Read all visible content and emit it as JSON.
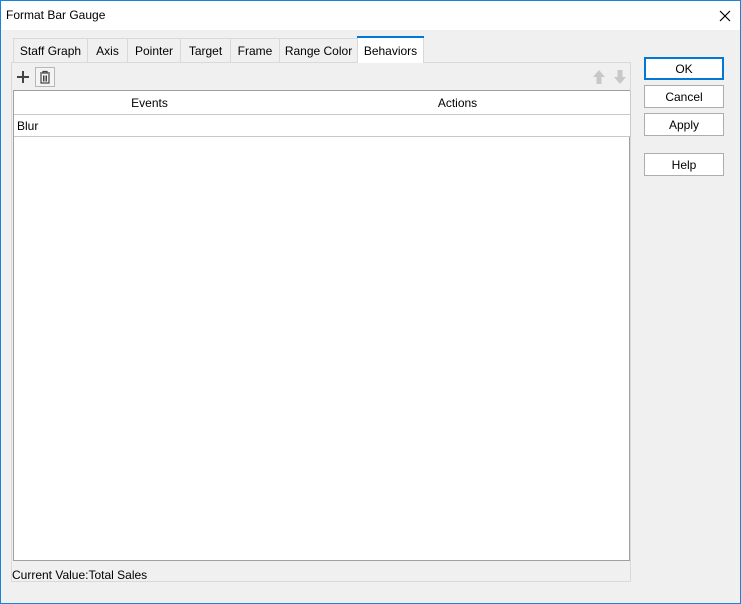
{
  "window": {
    "title": "Format Bar Gauge"
  },
  "tabs": [
    "Staff Graph",
    "Axis",
    "Pointer",
    "Target",
    "Frame",
    "Range Color",
    "Behaviors"
  ],
  "active_tab": "Behaviors",
  "toolbar": {
    "add_icon": "plus-icon",
    "delete_icon": "trash-icon",
    "move_up_icon": "arrow-up-icon",
    "move_down_icon": "arrow-down-icon"
  },
  "table": {
    "columns": [
      "Events",
      "Actions"
    ],
    "rows": [
      {
        "event": "Blur",
        "action": ""
      }
    ]
  },
  "status": "Current Value:Total Sales",
  "buttons": {
    "ok": "OK",
    "cancel": "Cancel",
    "apply": "Apply",
    "help": "Help"
  },
  "colors": {
    "accent": "#0078d7",
    "window_border": "#1883d7"
  }
}
